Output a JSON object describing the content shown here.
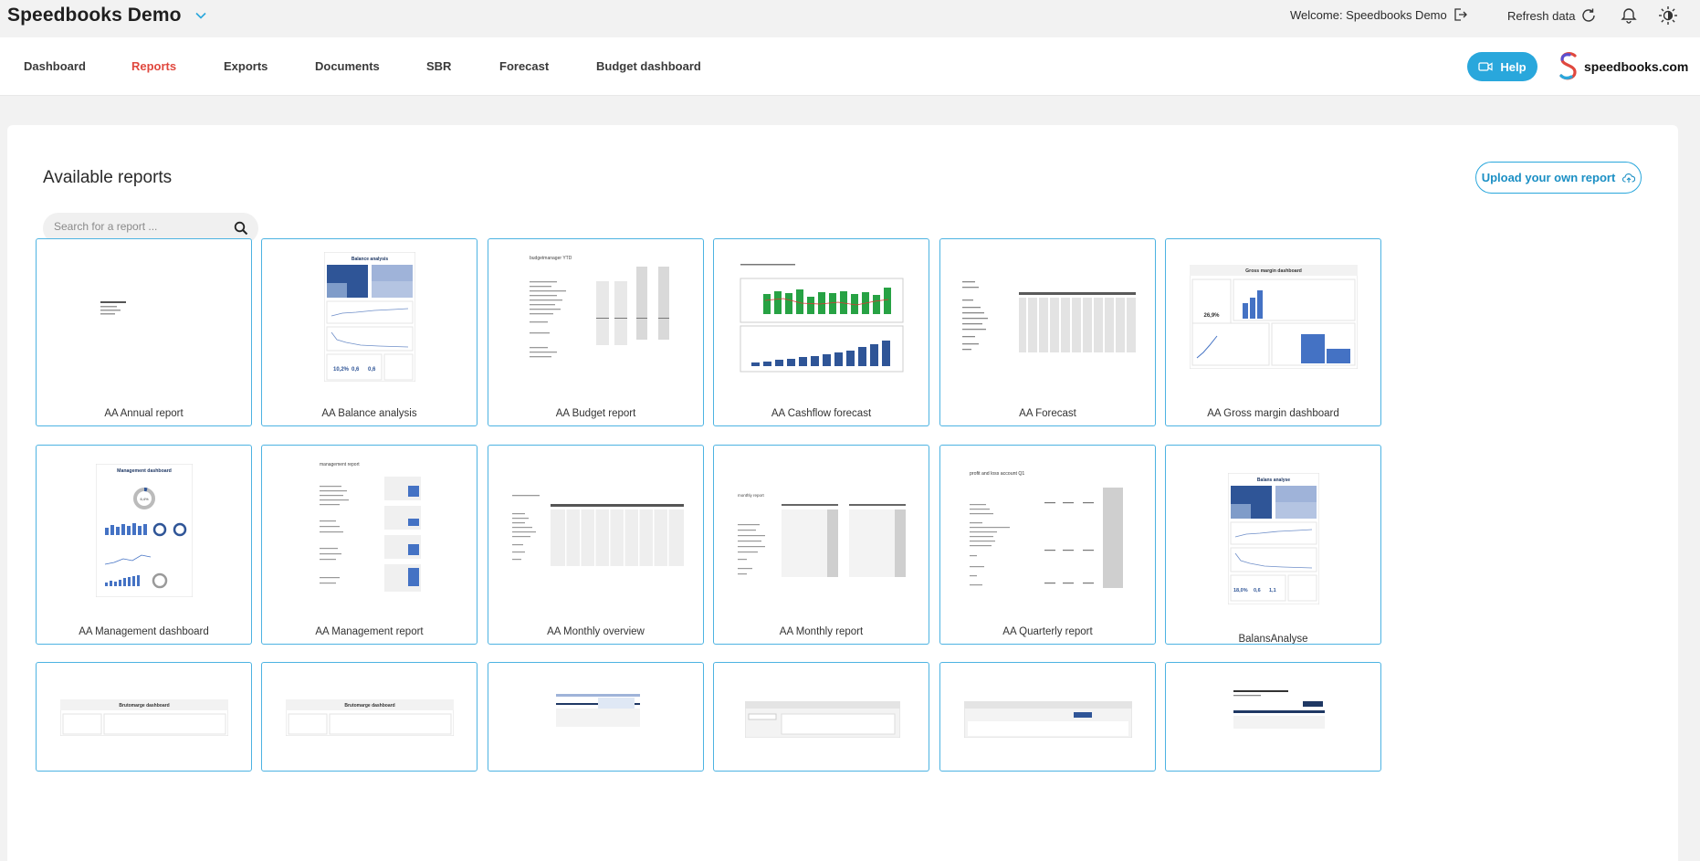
{
  "app": {
    "title": "Speedbooks Demo",
    "welcome": "Welcome: Speedbooks Demo",
    "refresh_label": "Refresh data"
  },
  "nav": {
    "items": [
      "Dashboard",
      "Reports",
      "Exports",
      "Documents",
      "SBR",
      "Forecast",
      "Budget dashboard"
    ],
    "active": "Reports",
    "help_label": "Help",
    "logo_text": "speedbooks.com"
  },
  "page": {
    "title": "Available reports",
    "upload_label": "Upload your own report",
    "search_placeholder": "Search for a report ..."
  },
  "reports": [
    "AA Annual report",
    "AA Balance analysis",
    "AA Budget report",
    "AA Cashflow forecast",
    "AA Forecast",
    "AA Gross margin dashboard",
    "AA Management dashboard",
    "AA Management report",
    "AA Monthly overview",
    "AA Monthly report",
    "AA Quarterly report",
    "BalansAnalyse"
  ],
  "thumb_text": {
    "balance_title": "Balance analysis",
    "gross_title": "Gross margin dashboard",
    "mgmt_title": "Management dashboard",
    "bruto_title": "Brutomarge dashboard",
    "balans_title": "Balans analyse",
    "quarterly_title": "profit and loss account Q1",
    "budget_title": "budgetmanager YTD",
    "mgmt_report_title": "management report",
    "monthly_title": "monthly report",
    "kpi_a": "10,2%",
    "kpi_b": "0,6",
    "kpi_c": "0,6",
    "gm_pct": "26,9%",
    "gauge_pct": "6,4%",
    "balans_a": "18,0%",
    "balans_b": "0,6",
    "balans_c": "1,1"
  },
  "colors": {
    "accent": "#29a7dc",
    "active_nav": "#e0483e",
    "tile_border": "#4db3e2"
  }
}
